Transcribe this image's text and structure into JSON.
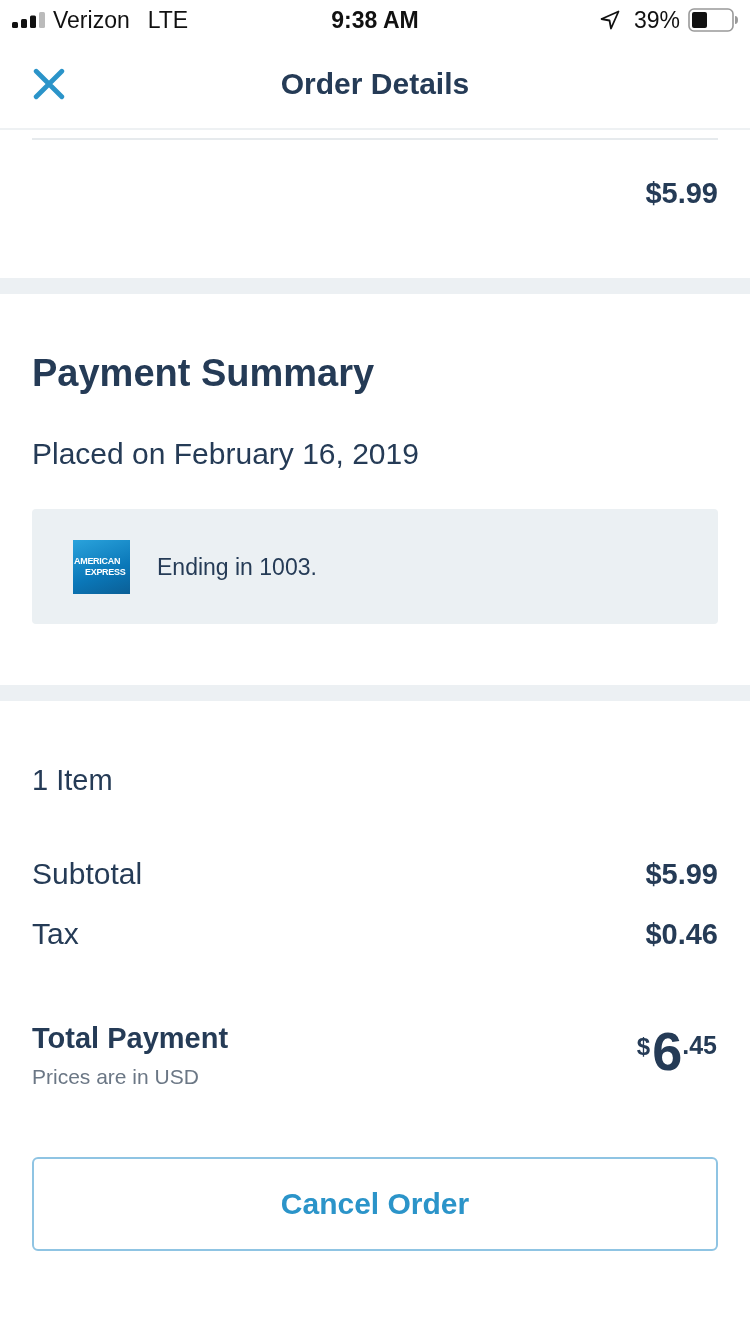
{
  "status_bar": {
    "carrier": "Verizon",
    "network": "LTE",
    "time": "9:38 AM",
    "battery": "39%"
  },
  "nav": {
    "title": "Order Details"
  },
  "item_section": {
    "price": "$5.99"
  },
  "payment_summary": {
    "title": "Payment Summary",
    "placed_on": "Placed on February 16, 2019",
    "card": {
      "logo_text": [
        "AMERICAN",
        "EXPRESS"
      ],
      "label": "Ending in 1003."
    }
  },
  "totals": {
    "item_count": "1 Item",
    "lines": [
      {
        "label": "Subtotal",
        "value": "$5.99"
      },
      {
        "label": "Tax",
        "value": "$0.46"
      }
    ],
    "total": {
      "label": "Total Payment",
      "note": "Prices are in USD",
      "amount": {
        "currency": "$",
        "whole": "6",
        "fraction": ".45"
      }
    }
  },
  "actions": [
    {
      "label": "Cancel Order"
    }
  ]
}
